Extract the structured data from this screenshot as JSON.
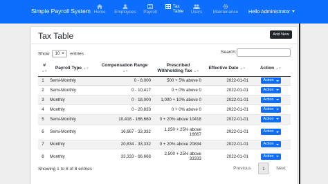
{
  "navbar": {
    "brand": "Simple Payroll System",
    "items": [
      {
        "label": "Home",
        "icon": "home-icon",
        "active": false
      },
      {
        "label": "Employees",
        "icon": "employees-icon",
        "active": false
      },
      {
        "label": "Payroll",
        "icon": "payroll-icon",
        "active": false
      },
      {
        "label": "Tax Table",
        "icon": "table-icon",
        "active": true
      },
      {
        "label": "Users",
        "icon": "users-icon",
        "active": false
      },
      {
        "label": "Maintenance",
        "icon": "maintenance-icon",
        "active": false
      }
    ],
    "user_menu": "Hello Administrator"
  },
  "page": {
    "title": "Tax Table",
    "add_button": "Add New"
  },
  "controls": {
    "show_label": "Show",
    "page_size": "10",
    "entries_label": "entries",
    "search_label": "Search:",
    "search_value": ""
  },
  "table": {
    "headers": [
      "#",
      "Payroll Type",
      "Compensation Range",
      "Prescribed Withholding Tax",
      "Effective Date",
      "Action"
    ],
    "action_label": "Action",
    "rows": [
      {
        "num": "1",
        "type": "Semi-Monthly",
        "range": "0 - 8,000",
        "tax": "500 + 5% above 0",
        "date": "2022-01-01"
      },
      {
        "num": "2",
        "type": "Semi-Monthly",
        "range": "0 - 10,417",
        "tax": "0 + 0% above 0",
        "date": "2022-01-01"
      },
      {
        "num": "3",
        "type": "Monthly",
        "range": "0 - 18,000",
        "tax": "1,000 + 10% above 0",
        "date": "2022-01-01"
      },
      {
        "num": "4",
        "type": "Monthly",
        "range": "0 - 20,833",
        "tax": "0 + 0% above 0",
        "date": "2022-01-01"
      },
      {
        "num": "5",
        "type": "Semi-Monthly",
        "range": "10,418 - 166,660",
        "tax": "0 + 20% above 10418",
        "date": "2022-01-01"
      },
      {
        "num": "6",
        "type": "Semi-Monthly",
        "range": "16,667 - 33,332",
        "tax": "1,250 + 25% above 16667",
        "date": "2022-01-01"
      },
      {
        "num": "7",
        "type": "Monthly",
        "range": "20,834 - 33,332",
        "tax": "0 + 20% above 20834",
        "date": "2022-01-01"
      },
      {
        "num": "8",
        "type": "Monthly",
        "range": "33,333 - 66,666",
        "tax": "2,500 + 25% above 33333",
        "date": "2022-01-01"
      }
    ]
  },
  "footer": {
    "info": "Showing 1 to 8 of 8 entries",
    "previous": "Previous",
    "current_page": "1",
    "next": "Next"
  },
  "colors": {
    "navbar": "#0d6efd",
    "action_button": "#0d6efd",
    "add_button": "#212529"
  }
}
